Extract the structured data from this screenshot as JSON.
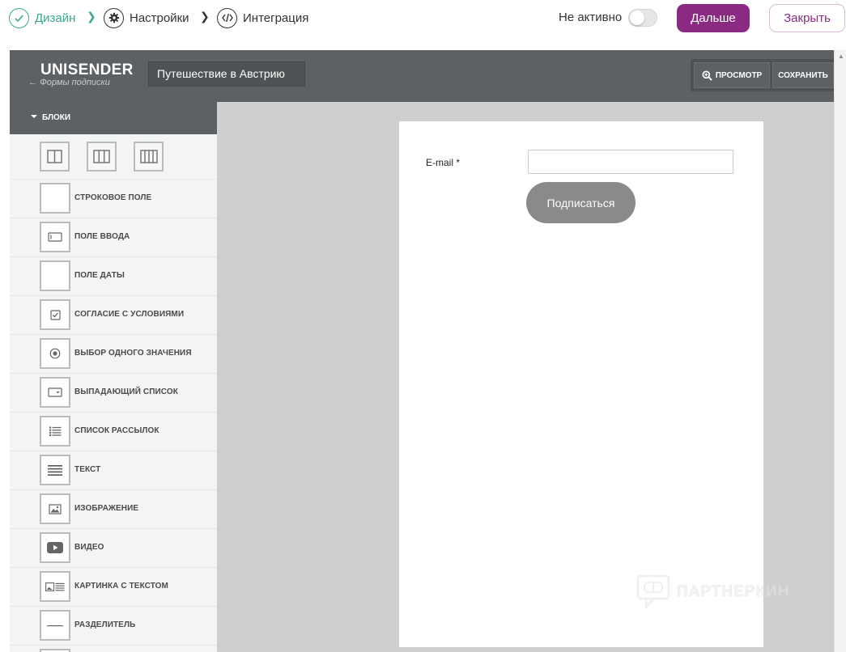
{
  "stepper": {
    "steps": [
      {
        "label": "Дизайн",
        "state": "done"
      },
      {
        "label": "Настройки",
        "state": "pending"
      },
      {
        "label": "Интеграция",
        "state": "pending"
      }
    ]
  },
  "status": {
    "label": "Не активно",
    "active": false
  },
  "actions": {
    "next_label": "Дальше",
    "close_label": "Закрыть"
  },
  "colors": {
    "accent": "#8a2a83",
    "success": "#3aa88f",
    "panel": "#5d6164"
  },
  "editor": {
    "logo": "UNISENDER",
    "back_link": "Формы подписки",
    "form_name": "Путешествие в Австрию",
    "preview_label": "ПРОСМОТР",
    "save_label": "СОХРАНИТЬ"
  },
  "sidebar": {
    "title": "БЛОКИ",
    "layouts": [
      "two-column-layout-icon",
      "three-column-layout-icon",
      "four-column-layout-icon"
    ],
    "items": [
      {
        "label": "СТРОКОВОЕ ПОЛЕ",
        "icon": "string-field-icon"
      },
      {
        "label": "ПОЛЕ ВВОДА",
        "icon": "input-field-icon"
      },
      {
        "label": "ПОЛЕ ДАТЫ",
        "icon": "date-field-icon"
      },
      {
        "label": "СОГЛАСИЕ С УСЛОВИЯМИ",
        "icon": "checkbox-icon"
      },
      {
        "label": "ВЫБОР ОДНОГО ЗНАЧЕНИЯ",
        "icon": "radio-icon"
      },
      {
        "label": "ВЫПАДАЮЩИЙ СПИСОК",
        "icon": "dropdown-icon"
      },
      {
        "label": "СПИСОК РАССЫЛОК",
        "icon": "mailing-list-icon"
      },
      {
        "label": "ТЕКСТ",
        "icon": "text-icon"
      },
      {
        "label": "ИЗОБРАЖЕНИЕ",
        "icon": "image-icon"
      },
      {
        "label": "ВИДЕО",
        "icon": "video-icon"
      },
      {
        "label": "КАРТИНКА С ТЕКСТОМ",
        "icon": "image-text-icon"
      },
      {
        "label": "РАЗДЕЛИТЕЛЬ",
        "icon": "divider-icon"
      },
      {
        "label": "",
        "icon": "more-block-icon"
      }
    ]
  },
  "form": {
    "email_label": "E-mail *",
    "email_value": "",
    "subscribe_label": "Подписаться"
  },
  "watermark": {
    "text": "ПАРТНЕРКИН"
  }
}
